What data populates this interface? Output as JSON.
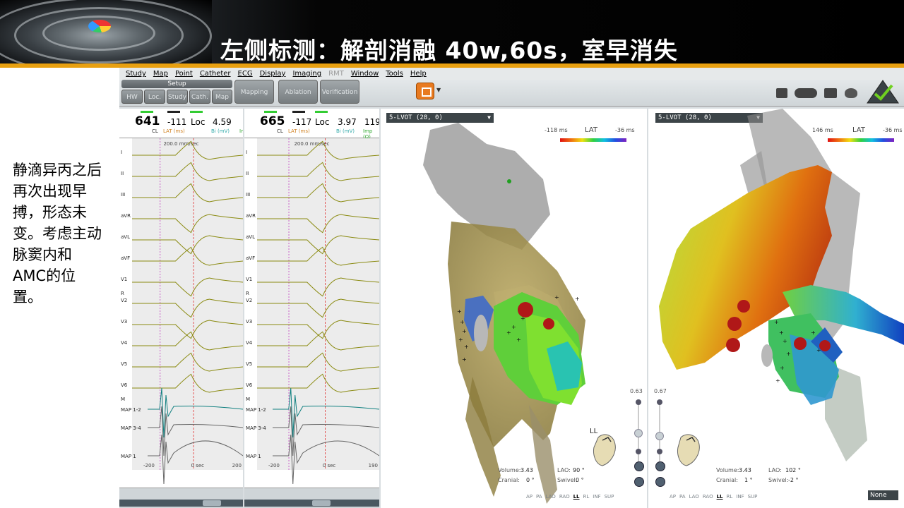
{
  "header": {
    "title": "左侧标测：解剖消融 40w,60s，室早消失"
  },
  "side_note": {
    "text": "静滴异丙之后再次出现早搏，形态未变。考虑主动脉窦内和AMC的位置。"
  },
  "menu": {
    "items": [
      "Study",
      "Map",
      "Point",
      "Catheter",
      "ECG",
      "Display",
      "Imaging",
      "RMT",
      "Window",
      "Tools",
      "Help"
    ]
  },
  "toolbar": {
    "setup_label": "Setup",
    "setup_buttons": [
      "HW",
      "Loc.",
      "Study",
      "Cath.",
      "Map"
    ],
    "mapping": "Mapping",
    "ablation": "Ablation",
    "verification": "Verification"
  },
  "ecg_left": {
    "cl_value": "641",
    "cl_label": "CL",
    "lat_value": "-111",
    "lat_label": "LAT (ms)",
    "loc_label": "Loc",
    "bi_value": "4.59",
    "bi_label": "Bi (mV)",
    "imp_label": "Im",
    "speed": "200.0 mm/sec",
    "axis_left": "-200",
    "axis_mid": "0 sec",
    "axis_right": "200",
    "leads": [
      "I",
      "II",
      "III",
      "aVR",
      "aVL",
      "aVF",
      "V1",
      "V2",
      "V3",
      "V4",
      "V5",
      "V6"
    ],
    "map_leads": [
      "MAP 1-2",
      "MAP 3-4",
      "MAP 1"
    ],
    "r_label": "R",
    "m_label": "M"
  },
  "ecg_right": {
    "cl_value": "665",
    "cl_label": "CL",
    "lat_value": "-117",
    "lat_label": "LAT (ms)",
    "loc_label": "Loc",
    "bi_value": "3.97",
    "bi_label": "Bi (mV)",
    "imp_value": "119",
    "imp_label": "Imp (Ω)",
    "speed": "200.0 mm/sec",
    "axis_left": "-200",
    "axis_mid": "0 sec",
    "axis_right": "190",
    "leads": [
      "I",
      "II",
      "III",
      "aVR",
      "aVL",
      "aVF",
      "V1",
      "V2",
      "V3",
      "V4",
      "V5",
      "V6"
    ],
    "map_leads": [
      "MAP 1-2",
      "MAP 3-4",
      "MAP 1"
    ],
    "r_label": "R",
    "m_label": "M"
  },
  "map_left": {
    "select": "5-LVOT (28, 0)",
    "lat_min": "-118 ms",
    "lat_title": "LAT",
    "lat_max": "-36 ms",
    "view_label": "LL",
    "slider_value": "0.63",
    "volume_label": "Volume:",
    "volume": "3.43",
    "lao_label": "LAO:",
    "lao": "90 °",
    "cranial_label": "Cranial:",
    "cranial": "0 °",
    "swivel_label": "Swivel:",
    "swivel": "0 °",
    "views": [
      "AP",
      "PA",
      "LAO",
      "RAO",
      "LL",
      "RL",
      "INF",
      "SUP"
    ],
    "active_view": "LL"
  },
  "map_right": {
    "select": "5-LVOT (28, 0)",
    "lat_min": "146 ms",
    "lat_title": "LAT",
    "lat_max": "-36 ms",
    "slider_value": "0.67",
    "volume_label": "Volume:",
    "volume": "3.43",
    "lao_label": "LAO:",
    "lao": "102 °",
    "cranial_label": "Cranial:",
    "cranial": "1 °",
    "swivel_label": "Swivel:",
    "swivel": "-2 °",
    "views": [
      "AP",
      "PA",
      "LAO",
      "RAO",
      "LL",
      "RL",
      "INF",
      "SUP"
    ],
    "active_view": "LL",
    "dropdown": "None"
  },
  "colors": {
    "accent": "#e8a010",
    "ecg_trace": "#8a8a10",
    "ecg_marker": "#e03030",
    "map_trace": "#108080"
  }
}
